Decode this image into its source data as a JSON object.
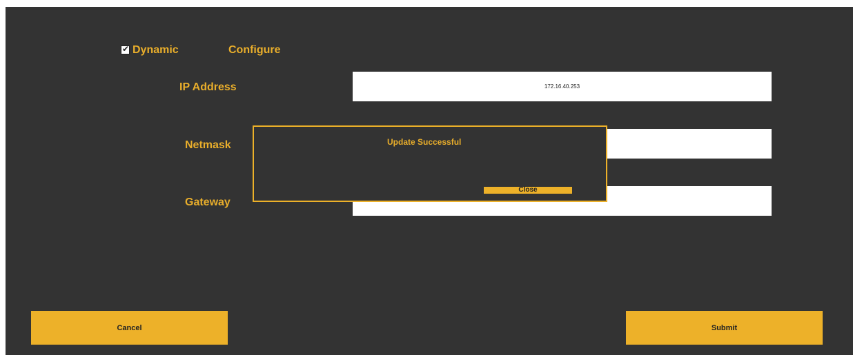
{
  "network_settings": {
    "dynamic_label": "Dynamic",
    "dynamic_checked": true,
    "configure_label": "Configure",
    "ip_address": {
      "label": "IP Address",
      "value": "172.16.40.253"
    },
    "netmask": {
      "label": "Netmask",
      "value": ""
    },
    "gateway": {
      "label": "Gateway",
      "value": ""
    }
  },
  "dialog": {
    "message": "Update Successful",
    "close_label": "Close"
  },
  "footer": {
    "cancel_label": "Cancel",
    "submit_label": "Submit"
  },
  "colors": {
    "background": "#333333",
    "accent": "#edb129",
    "field": "#ffffff"
  }
}
